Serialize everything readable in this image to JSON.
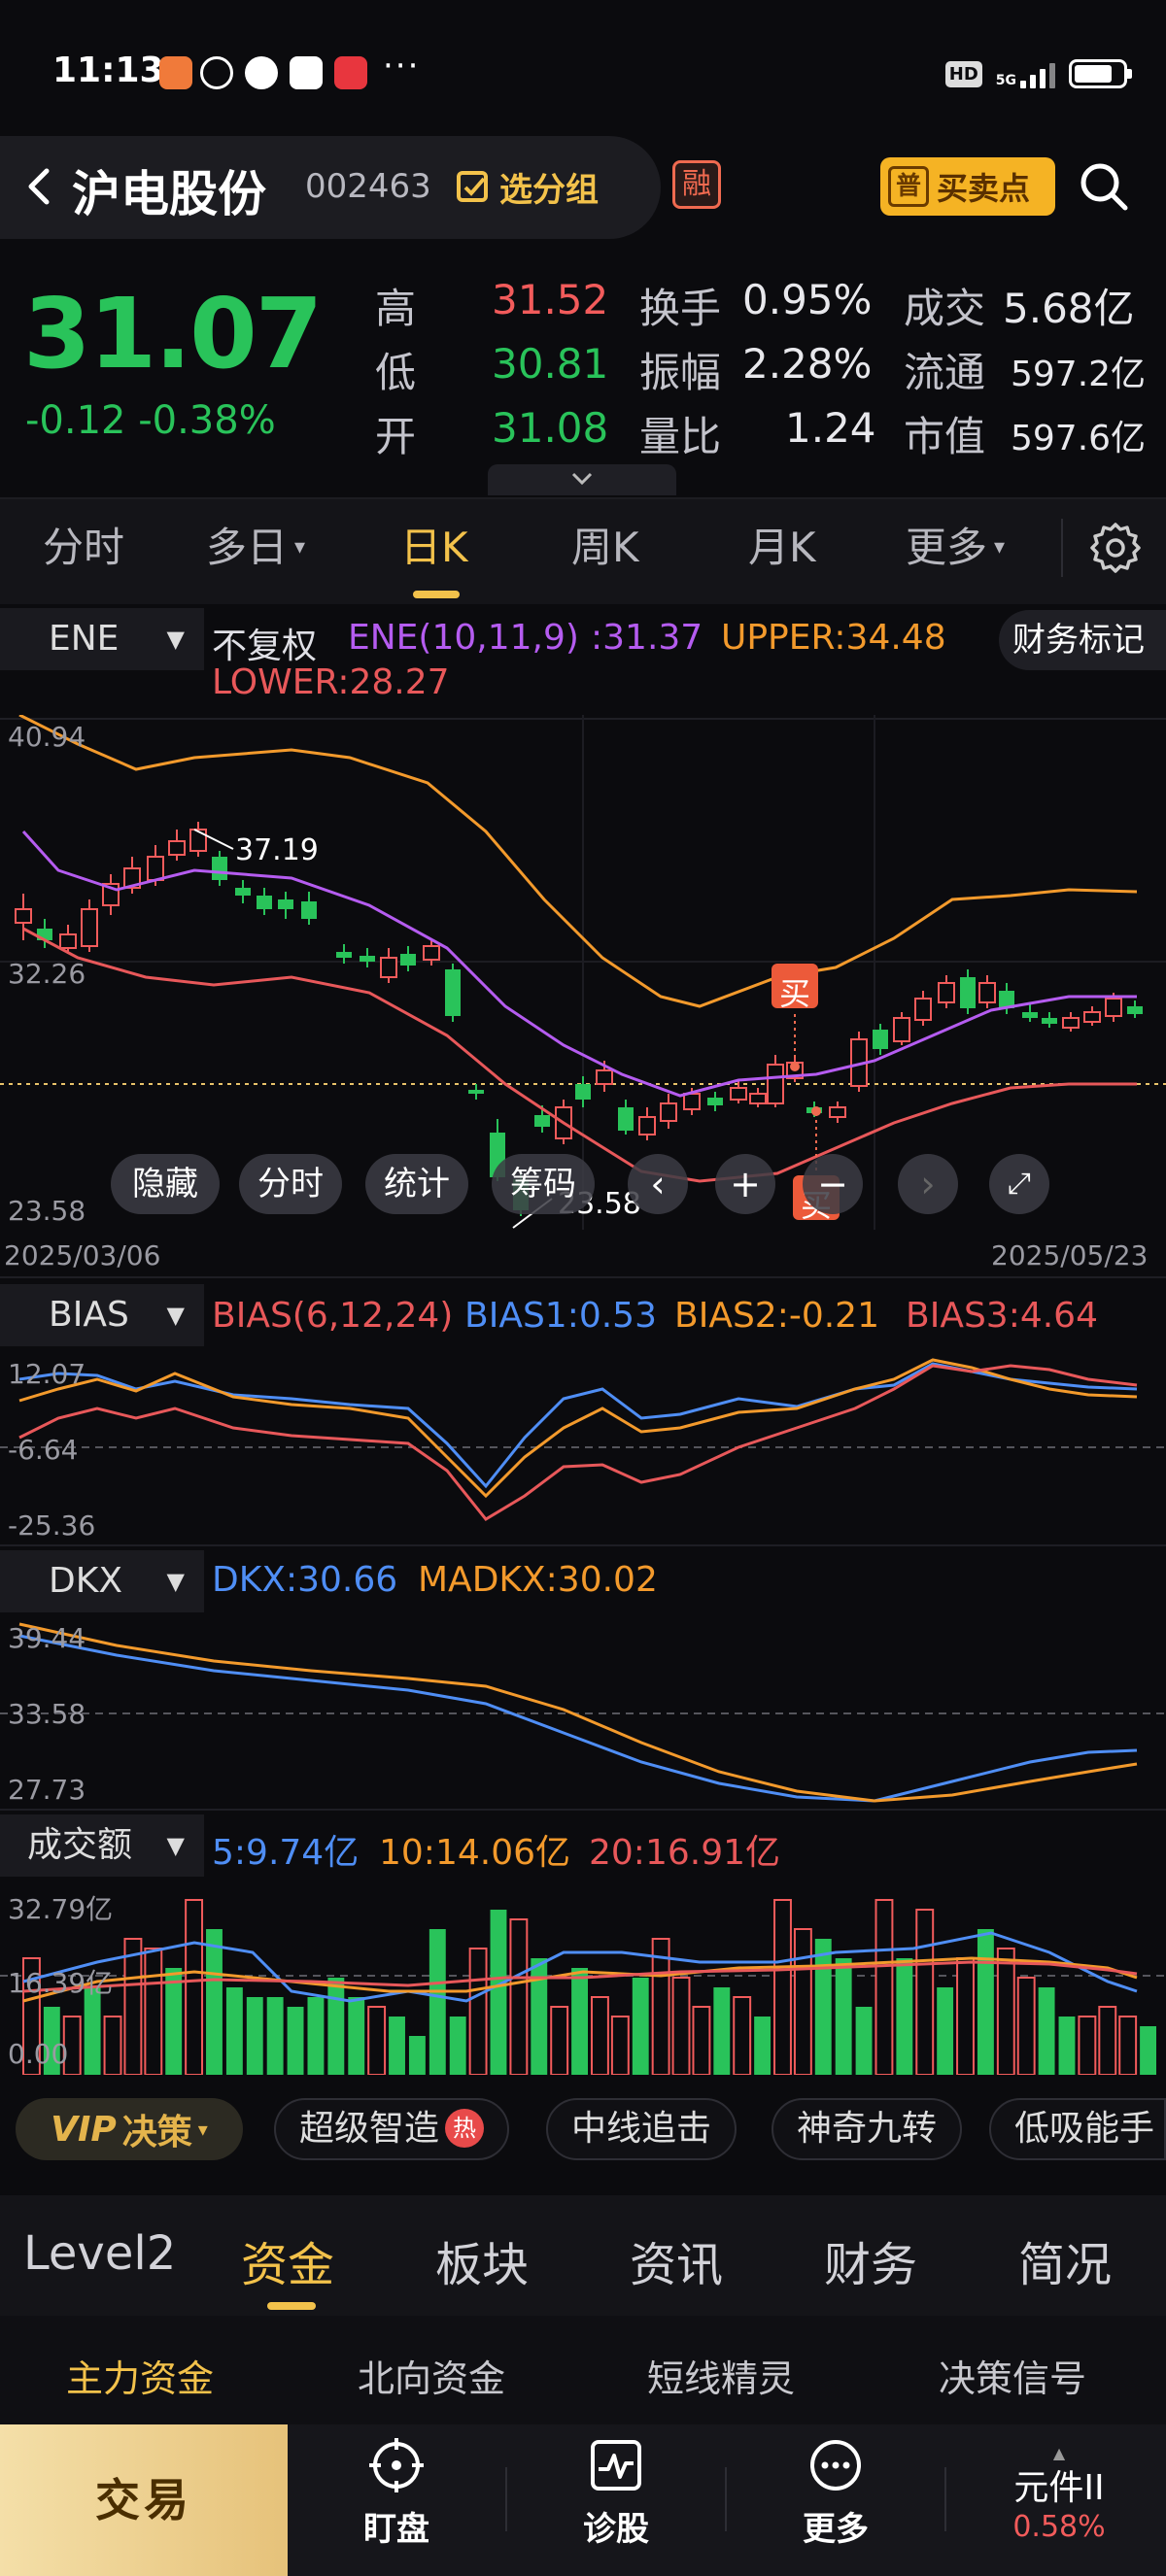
{
  "status_bar": {
    "time": "11:13",
    "dots": "···",
    "hd": "HD",
    "net": "5G"
  },
  "header": {
    "stock_name": "沪电股份",
    "stock_code": "002463",
    "select_group": "选分组",
    "rong_badge": "融",
    "pu_badge": "普",
    "buy_sell_point": "买卖点"
  },
  "quote": {
    "price": "31.07",
    "change": "-0.12 -0.38%",
    "labels": {
      "high": "高",
      "low": "低",
      "open": "开",
      "turnover": "换手",
      "amplitude": "振幅",
      "vol_ratio": "量比",
      "deal": "成交",
      "float": "流通",
      "mktcap": "市值"
    },
    "values": {
      "high": "31.52",
      "low": "30.81",
      "open": "31.08",
      "turnover": "0.95%",
      "amplitude": "2.28%",
      "vol_ratio": "1.24",
      "deal": "5.68亿",
      "float": "597.2亿",
      "mktcap": "597.6亿"
    }
  },
  "period_tabs": [
    "分时",
    "多日",
    "日K",
    "周K",
    "月K",
    "更多"
  ],
  "main_chart": {
    "indicator": "ENE",
    "adjust": "不复权",
    "ene_label": "ENE(10,11,9)",
    "ene_value": ":31.37",
    "upper": "UPPER:34.48",
    "lower": "LOWER:28.27",
    "fin_mark": "财务标记",
    "y_top": "40.94",
    "y_mid": "32.26",
    "y_bot": "23.58",
    "max_label": "37.19",
    "min_label": "23.58",
    "date_start": "2025/03/06",
    "date_end": "2025/05/23",
    "buy_marker": "买",
    "buttons": {
      "hide": "隐藏",
      "timeshare": "分时",
      "stats": "统计",
      "chips": "筹码"
    }
  },
  "bias": {
    "indicator": "BIAS",
    "label": "BIAS(6,12,24)",
    "b1": "BIAS1:0.53",
    "b2": "BIAS2:-0.21",
    "b3": "BIAS3:4.64",
    "y_top": "12.07",
    "y_mid": "-6.64",
    "y_bot": "-25.36"
  },
  "dkx": {
    "indicator": "DKX",
    "dkx": "DKX:30.66",
    "madkx": "MADKX:30.02",
    "y_top": "39.44",
    "y_mid": "33.58",
    "y_bot": "27.73"
  },
  "amount": {
    "indicator": "成交额",
    "ma5": "5:9.74亿",
    "ma10": "10:14.06亿",
    "ma20": "20:16.91亿",
    "y_top": "32.79亿",
    "y_mid": "16.39亿",
    "y_bot": "0.00"
  },
  "strategy_chips": {
    "vip": "VIP",
    "decision": "决策",
    "items": [
      "超级智造",
      "中线追击",
      "神奇九转",
      "低吸能手"
    ],
    "hot": "热"
  },
  "main_tabs": [
    "Level2",
    "资金",
    "板块",
    "资讯",
    "财务",
    "简况"
  ],
  "sub_tabs": [
    "主力资金",
    "北向资金",
    "短线精灵",
    "决策信号"
  ],
  "bottom_nav": {
    "trade": "交易",
    "items": [
      "盯盘",
      "诊股",
      "更多"
    ],
    "index_name": "元件II",
    "index_pct": "0.58%"
  },
  "colors": {
    "up": "#f25b5b",
    "down": "#29c35a",
    "accent": "#f3c24b",
    "ene_mid": "#b55cf0",
    "upper": "#f39a2c",
    "lower": "#e8585a",
    "bias1": "#4f8ef5"
  }
}
